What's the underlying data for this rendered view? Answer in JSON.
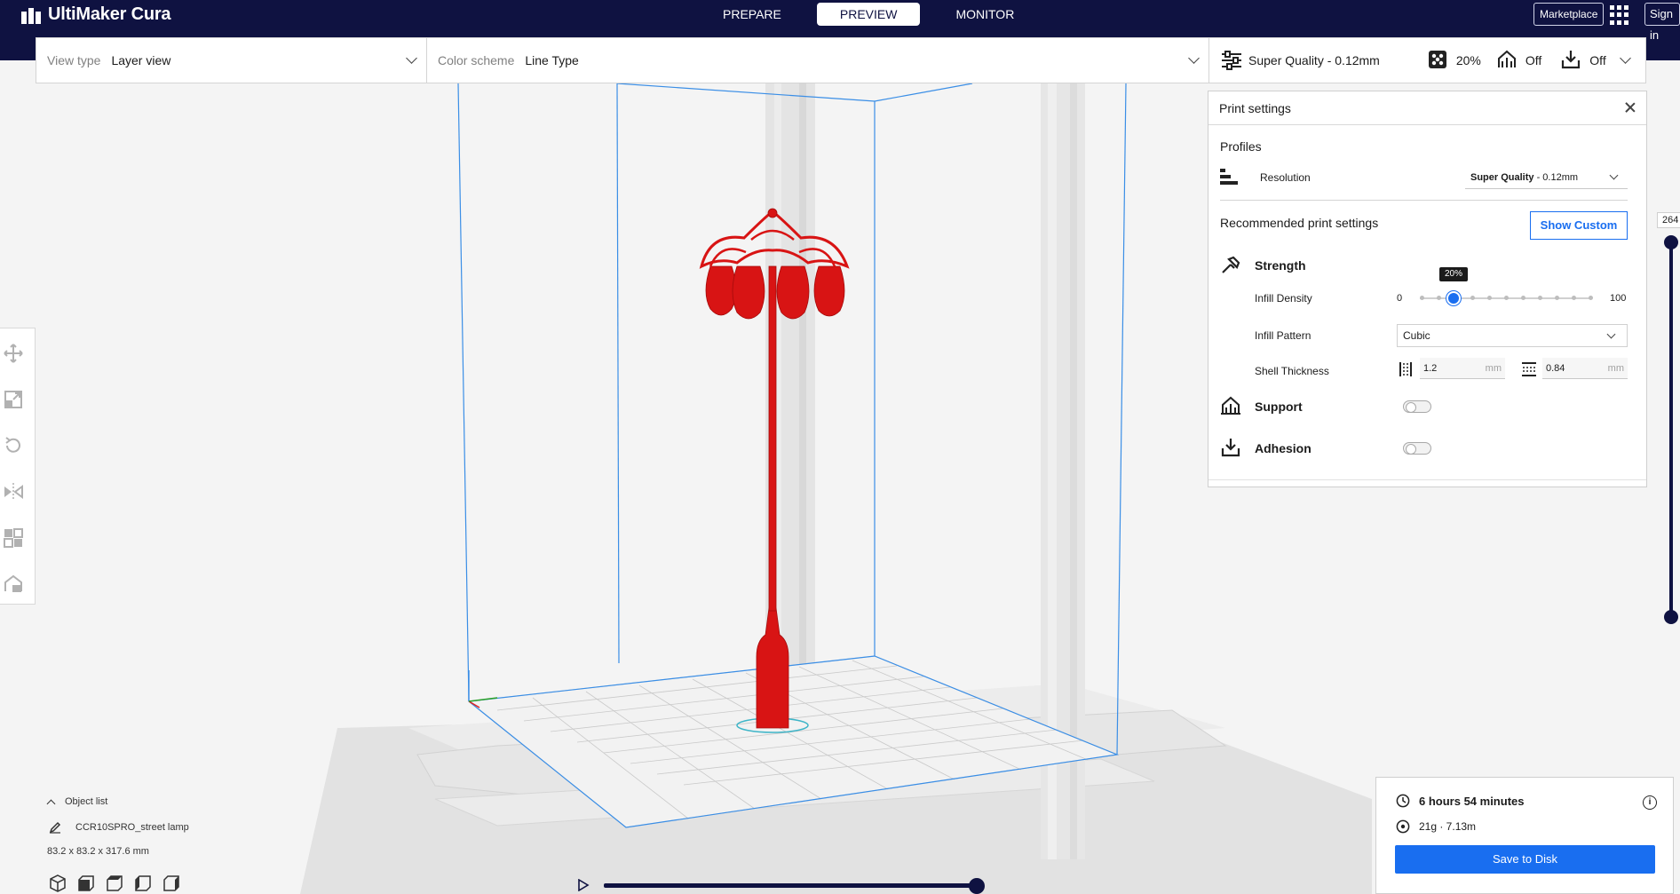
{
  "app": {
    "name": "UltiMaker Cura"
  },
  "stages": [
    {
      "label": "PREPARE",
      "active": false
    },
    {
      "label": "PREVIEW",
      "active": true
    },
    {
      "label": "MONITOR",
      "active": false
    }
  ],
  "topbar": {
    "marketplace_label": "Marketplace",
    "signin_label": "Sign in"
  },
  "toolbar": {
    "view_type_label": "View type",
    "view_type_value": "Layer view",
    "color_scheme_label": "Color scheme",
    "color_scheme_value": "Line Type"
  },
  "quality_bar": {
    "profile": "Super Quality - 0.12mm",
    "infill": "20%",
    "support": "Off",
    "adhesion": "Off"
  },
  "print_settings": {
    "title": "Print settings",
    "profiles_label": "Profiles",
    "resolution_label": "Resolution",
    "resolution_value_bold": "Super Quality",
    "resolution_value_rest": " - 0.12mm",
    "recommended_label": "Recommended print settings",
    "show_custom_label": "Show Custom",
    "strength_label": "Strength",
    "infill_density_label": "Infill Density",
    "infill_min": "0",
    "infill_max": "100",
    "infill_value": 20,
    "infill_tip": "20%",
    "infill_pattern_label": "Infill Pattern",
    "infill_pattern_value": "Cubic",
    "shell_thickness_label": "Shell Thickness",
    "wall_value": "1.2",
    "top_bottom_value": "0.84",
    "unit_mm": "mm",
    "support_label": "Support",
    "support_enabled": false,
    "adhesion_label": "Adhesion",
    "adhesion_enabled": false
  },
  "layer_slider": {
    "current_layer": "264"
  },
  "object_list": {
    "header": "Object list",
    "object_name": "CCR10SPRO_street lamp",
    "dimensions": "83.2 x 83.2 x 317.6 mm"
  },
  "estimate": {
    "time": "6 hours 54 minutes",
    "material": "21g · 7.13m",
    "save_label": "Save to Disk"
  },
  "colors": {
    "topbar": "#0f1241",
    "accent": "#196ef0",
    "model": "#d81414",
    "build_volume": "#3a8ee6"
  },
  "icons": [
    "settings-sliders-icon",
    "infill-icon",
    "support-icon",
    "adhesion-icon",
    "strength-icon",
    "move-icon",
    "scale-icon",
    "rotate-icon",
    "mirror-icon",
    "per-model-settings-icon",
    "support-blocker-icon",
    "apps-grid-icon",
    "clock-icon",
    "spool-icon",
    "info-icon",
    "pencil-icon",
    "play-icon"
  ]
}
